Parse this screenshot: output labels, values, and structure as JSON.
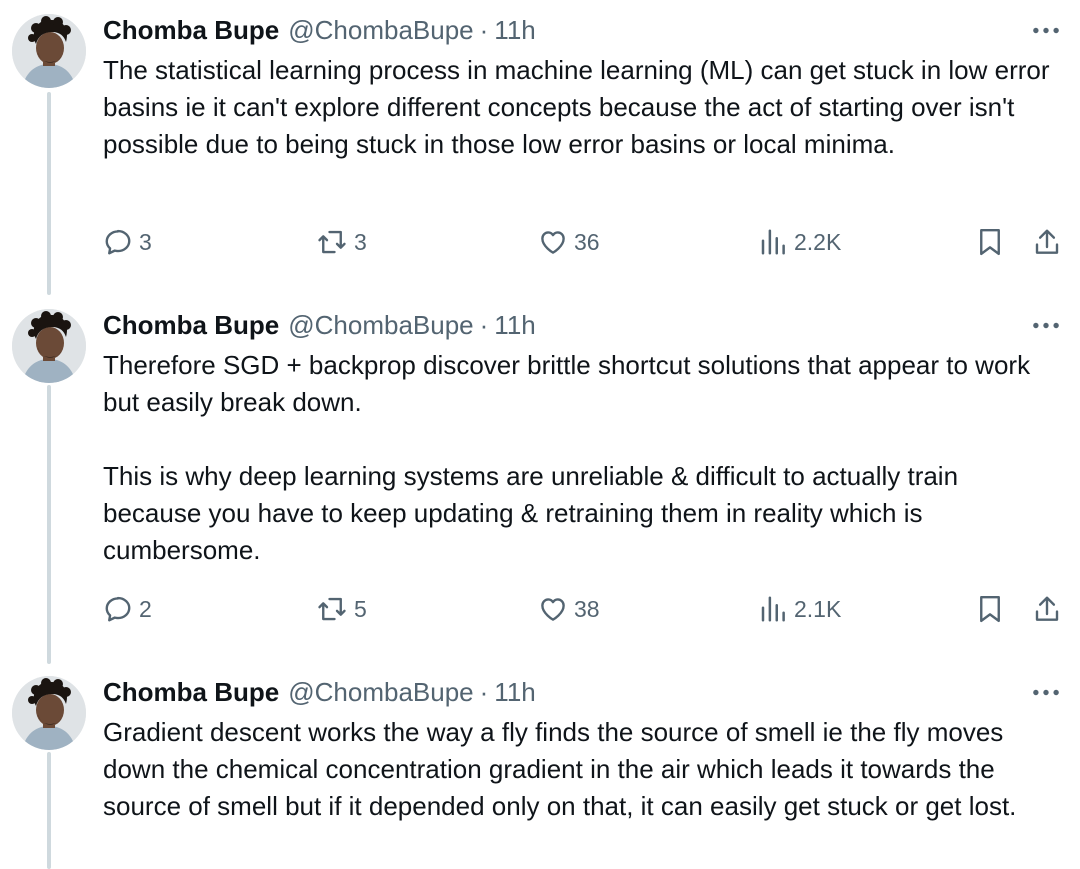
{
  "tweets": [
    {
      "author": {
        "name": "Chomba Bupe",
        "handle": "@ChombaBupe"
      },
      "separator": "·",
      "time": "11h",
      "text": "The statistical learning process in machine learning (ML) can get stuck in low error basins ie it can't explore different concepts because the act of starting over isn't possible due to being stuck in those low error basins or local minima.",
      "stats": {
        "replies": "3",
        "reposts": "3",
        "likes": "36",
        "views": "2.2K"
      }
    },
    {
      "author": {
        "name": "Chomba Bupe",
        "handle": "@ChombaBupe"
      },
      "separator": "·",
      "time": "11h",
      "text": "Therefore SGD + backprop discover brittle shortcut solutions that appear to work but easily break down.\n\nThis is why deep learning systems are unreliable & difficult to actually train because you have to keep updating & retraining them in reality which is cumbersome.",
      "stats": {
        "replies": "2",
        "reposts": "5",
        "likes": "38",
        "views": "2.1K"
      }
    },
    {
      "author": {
        "name": "Chomba Bupe",
        "handle": "@ChombaBupe"
      },
      "separator": "·",
      "time": "11h",
      "text": "Gradient descent works the way a fly finds the source of smell ie the fly moves down the chemical concentration gradient in the air which leads it towards the source of smell but if it depended only on that, it can easily get stuck or get lost."
    }
  ],
  "icons": {
    "reply": "reply-icon",
    "repost": "repost-icon",
    "like": "like-icon",
    "views": "views-icon",
    "bookmark": "bookmark-icon",
    "share": "share-icon",
    "more": "more-icon"
  },
  "colors": {
    "text": "#0f1419",
    "secondary": "#536471",
    "thread_line": "#cfd9de",
    "background": "#ffffff"
  }
}
